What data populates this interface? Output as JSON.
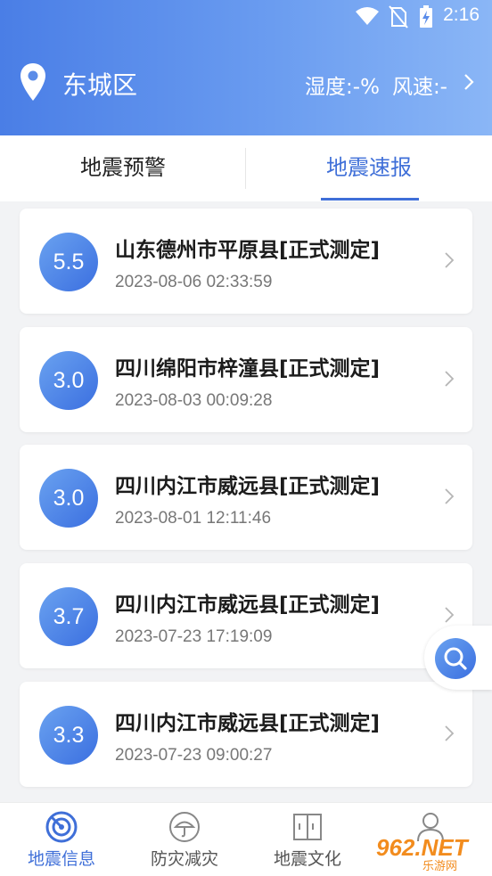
{
  "status_bar": {
    "time": "2:16",
    "icons": [
      "wifi-icon",
      "no-sim-icon",
      "battery-charging-icon"
    ]
  },
  "location": {
    "city": "东城区",
    "humidity": "湿度:-%",
    "wind": "风速:-"
  },
  "tabs": [
    {
      "label": "地震预警",
      "active": false
    },
    {
      "label": "地震速报",
      "active": true
    }
  ],
  "quakes": [
    {
      "mag": "5.5",
      "place": "山东德州市平原县[正式测定]",
      "time": "2023-08-06 02:33:59"
    },
    {
      "mag": "3.0",
      "place": "四川绵阳市梓潼县[正式测定]",
      "time": "2023-08-03 00:09:28"
    },
    {
      "mag": "3.0",
      "place": "四川内江市威远县[正式测定]",
      "time": "2023-08-01 12:11:46"
    },
    {
      "mag": "3.7",
      "place": "四川内江市威远县[正式测定]",
      "time": "2023-07-23 17:19:09"
    },
    {
      "mag": "3.3",
      "place": "四川内江市威远县[正式测定]",
      "time": "2023-07-23 09:00:27"
    }
  ],
  "bottom_nav": [
    {
      "label": "地震信息",
      "icon": "radar-icon",
      "active": true
    },
    {
      "label": "防灾减灾",
      "icon": "umbrella-icon",
      "active": false
    },
    {
      "label": "地震文化",
      "icon": "book-icon",
      "active": false
    },
    {
      "label": "",
      "icon": "user-icon",
      "active": false
    }
  ],
  "watermark": {
    "text": "962.NET",
    "sub": "乐游网"
  },
  "colors": {
    "accent": "#3f6fd8",
    "header_start": "#4a7ee6",
    "header_end": "#8ab6f6"
  }
}
